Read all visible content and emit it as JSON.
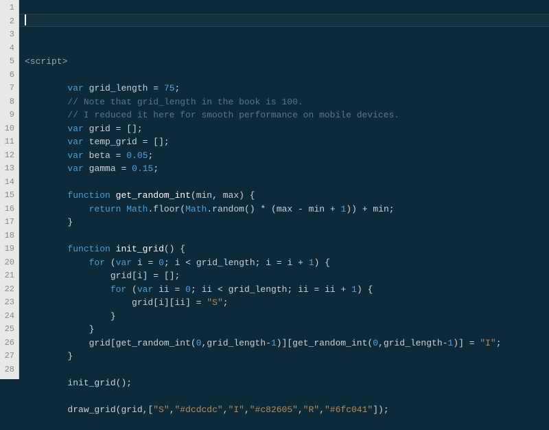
{
  "lines": [
    {
      "n": 1,
      "segs": [
        {
          "c": "tag",
          "t": "<script>"
        }
      ]
    },
    {
      "n": 2,
      "segs": []
    },
    {
      "n": 3,
      "segs": [
        {
          "c": "",
          "t": "        "
        },
        {
          "c": "kw",
          "t": "var"
        },
        {
          "c": "",
          "t": " "
        },
        {
          "c": "fn",
          "t": "grid_length"
        },
        {
          "c": "",
          "t": " "
        },
        {
          "c": "op",
          "t": "="
        },
        {
          "c": "",
          "t": " "
        },
        {
          "c": "num",
          "t": "75"
        },
        {
          "c": "punct",
          "t": ";"
        }
      ]
    },
    {
      "n": 4,
      "segs": [
        {
          "c": "",
          "t": "        "
        },
        {
          "c": "cm",
          "t": "// Note that grid_length in the book is 100."
        }
      ]
    },
    {
      "n": 5,
      "segs": [
        {
          "c": "",
          "t": "        "
        },
        {
          "c": "cm",
          "t": "// I reduced it here for smooth performance on mobile devices."
        }
      ]
    },
    {
      "n": 6,
      "segs": [
        {
          "c": "",
          "t": "        "
        },
        {
          "c": "kw",
          "t": "var"
        },
        {
          "c": "",
          "t": " "
        },
        {
          "c": "fn",
          "t": "grid"
        },
        {
          "c": "",
          "t": " "
        },
        {
          "c": "op",
          "t": "="
        },
        {
          "c": "",
          "t": " "
        },
        {
          "c": "punct",
          "t": "[]"
        },
        {
          "c": "punct",
          "t": ";"
        }
      ]
    },
    {
      "n": 7,
      "segs": [
        {
          "c": "",
          "t": "        "
        },
        {
          "c": "kw",
          "t": "var"
        },
        {
          "c": "",
          "t": " "
        },
        {
          "c": "fn",
          "t": "temp_grid"
        },
        {
          "c": "",
          "t": " "
        },
        {
          "c": "op",
          "t": "="
        },
        {
          "c": "",
          "t": " "
        },
        {
          "c": "punct",
          "t": "[]"
        },
        {
          "c": "punct",
          "t": ";"
        }
      ]
    },
    {
      "n": 8,
      "segs": [
        {
          "c": "",
          "t": "        "
        },
        {
          "c": "kw",
          "t": "var"
        },
        {
          "c": "",
          "t": " "
        },
        {
          "c": "fn",
          "t": "beta"
        },
        {
          "c": "",
          "t": " "
        },
        {
          "c": "op",
          "t": "="
        },
        {
          "c": "",
          "t": " "
        },
        {
          "c": "num",
          "t": "0.05"
        },
        {
          "c": "punct",
          "t": ";"
        }
      ]
    },
    {
      "n": 9,
      "segs": [
        {
          "c": "",
          "t": "        "
        },
        {
          "c": "kw",
          "t": "var"
        },
        {
          "c": "",
          "t": " "
        },
        {
          "c": "fn",
          "t": "gamma"
        },
        {
          "c": "",
          "t": " "
        },
        {
          "c": "op",
          "t": "="
        },
        {
          "c": "",
          "t": " "
        },
        {
          "c": "num",
          "t": "0.15"
        },
        {
          "c": "punct",
          "t": ";"
        }
      ]
    },
    {
      "n": 10,
      "segs": []
    },
    {
      "n": 11,
      "segs": [
        {
          "c": "",
          "t": "        "
        },
        {
          "c": "kw",
          "t": "function"
        },
        {
          "c": "",
          "t": " "
        },
        {
          "c": "white",
          "t": "get_random_int"
        },
        {
          "c": "punct",
          "t": "("
        },
        {
          "c": "fn",
          "t": "min"
        },
        {
          "c": "punct",
          "t": ","
        },
        {
          "c": "",
          "t": " "
        },
        {
          "c": "fn",
          "t": "max"
        },
        {
          "c": "punct",
          "t": ")"
        },
        {
          "c": "",
          "t": " "
        },
        {
          "c": "punct",
          "t": "{"
        }
      ]
    },
    {
      "n": 12,
      "segs": [
        {
          "c": "",
          "t": "            "
        },
        {
          "c": "kw",
          "t": "return"
        },
        {
          "c": "",
          "t": " "
        },
        {
          "c": "obj",
          "t": "Math"
        },
        {
          "c": "punct",
          "t": "."
        },
        {
          "c": "call",
          "t": "floor"
        },
        {
          "c": "punct",
          "t": "("
        },
        {
          "c": "obj",
          "t": "Math"
        },
        {
          "c": "punct",
          "t": "."
        },
        {
          "c": "call",
          "t": "random"
        },
        {
          "c": "punct",
          "t": "()"
        },
        {
          "c": "",
          "t": " "
        },
        {
          "c": "op",
          "t": "*"
        },
        {
          "c": "",
          "t": " "
        },
        {
          "c": "punct",
          "t": "("
        },
        {
          "c": "fn",
          "t": "max"
        },
        {
          "c": "",
          "t": " "
        },
        {
          "c": "op",
          "t": "-"
        },
        {
          "c": "",
          "t": " "
        },
        {
          "c": "fn",
          "t": "min"
        },
        {
          "c": "",
          "t": " "
        },
        {
          "c": "op",
          "t": "+"
        },
        {
          "c": "",
          "t": " "
        },
        {
          "c": "num",
          "t": "1"
        },
        {
          "c": "punct",
          "t": "))"
        },
        {
          "c": "",
          "t": " "
        },
        {
          "c": "op",
          "t": "+"
        },
        {
          "c": "",
          "t": " "
        },
        {
          "c": "fn",
          "t": "min"
        },
        {
          "c": "punct",
          "t": ";"
        }
      ]
    },
    {
      "n": 13,
      "segs": [
        {
          "c": "",
          "t": "        "
        },
        {
          "c": "punct",
          "t": "}"
        }
      ]
    },
    {
      "n": 14,
      "segs": []
    },
    {
      "n": 15,
      "segs": [
        {
          "c": "",
          "t": "        "
        },
        {
          "c": "kw",
          "t": "function"
        },
        {
          "c": "",
          "t": " "
        },
        {
          "c": "white",
          "t": "init_grid"
        },
        {
          "c": "punct",
          "t": "()"
        },
        {
          "c": "",
          "t": " "
        },
        {
          "c": "punct",
          "t": "{"
        }
      ]
    },
    {
      "n": 16,
      "segs": [
        {
          "c": "",
          "t": "            "
        },
        {
          "c": "kw",
          "t": "for"
        },
        {
          "c": "",
          "t": " "
        },
        {
          "c": "punct",
          "t": "("
        },
        {
          "c": "kw",
          "t": "var"
        },
        {
          "c": "",
          "t": " "
        },
        {
          "c": "fn",
          "t": "i"
        },
        {
          "c": "",
          "t": " "
        },
        {
          "c": "op",
          "t": "="
        },
        {
          "c": "",
          "t": " "
        },
        {
          "c": "num",
          "t": "0"
        },
        {
          "c": "punct",
          "t": ";"
        },
        {
          "c": "",
          "t": " "
        },
        {
          "c": "fn",
          "t": "i"
        },
        {
          "c": "",
          "t": " "
        },
        {
          "c": "op",
          "t": "<"
        },
        {
          "c": "",
          "t": " "
        },
        {
          "c": "fn",
          "t": "grid_length"
        },
        {
          "c": "punct",
          "t": ";"
        },
        {
          "c": "",
          "t": " "
        },
        {
          "c": "fn",
          "t": "i"
        },
        {
          "c": "",
          "t": " "
        },
        {
          "c": "op",
          "t": "="
        },
        {
          "c": "",
          "t": " "
        },
        {
          "c": "fn",
          "t": "i"
        },
        {
          "c": "",
          "t": " "
        },
        {
          "c": "op",
          "t": "+"
        },
        {
          "c": "",
          "t": " "
        },
        {
          "c": "num",
          "t": "1"
        },
        {
          "c": "punct",
          "t": ")"
        },
        {
          "c": "",
          "t": " "
        },
        {
          "c": "punct",
          "t": "{"
        }
      ]
    },
    {
      "n": 17,
      "segs": [
        {
          "c": "",
          "t": "                "
        },
        {
          "c": "fn",
          "t": "grid"
        },
        {
          "c": "punct",
          "t": "["
        },
        {
          "c": "fn",
          "t": "i"
        },
        {
          "c": "punct",
          "t": "]"
        },
        {
          "c": "",
          "t": " "
        },
        {
          "c": "op",
          "t": "="
        },
        {
          "c": "",
          "t": " "
        },
        {
          "c": "punct",
          "t": "[]"
        },
        {
          "c": "punct",
          "t": ";"
        }
      ]
    },
    {
      "n": 18,
      "segs": [
        {
          "c": "",
          "t": "                "
        },
        {
          "c": "kw",
          "t": "for"
        },
        {
          "c": "",
          "t": " "
        },
        {
          "c": "punct",
          "t": "("
        },
        {
          "c": "kw",
          "t": "var"
        },
        {
          "c": "",
          "t": " "
        },
        {
          "c": "fn",
          "t": "ii"
        },
        {
          "c": "",
          "t": " "
        },
        {
          "c": "op",
          "t": "="
        },
        {
          "c": "",
          "t": " "
        },
        {
          "c": "num",
          "t": "0"
        },
        {
          "c": "punct",
          "t": ";"
        },
        {
          "c": "",
          "t": " "
        },
        {
          "c": "fn",
          "t": "ii"
        },
        {
          "c": "",
          "t": " "
        },
        {
          "c": "op",
          "t": "<"
        },
        {
          "c": "",
          "t": " "
        },
        {
          "c": "fn",
          "t": "grid_length"
        },
        {
          "c": "punct",
          "t": ";"
        },
        {
          "c": "",
          "t": " "
        },
        {
          "c": "fn",
          "t": "ii"
        },
        {
          "c": "",
          "t": " "
        },
        {
          "c": "op",
          "t": "="
        },
        {
          "c": "",
          "t": " "
        },
        {
          "c": "fn",
          "t": "ii"
        },
        {
          "c": "",
          "t": " "
        },
        {
          "c": "op",
          "t": "+"
        },
        {
          "c": "",
          "t": " "
        },
        {
          "c": "num",
          "t": "1"
        },
        {
          "c": "punct",
          "t": ")"
        },
        {
          "c": "",
          "t": " "
        },
        {
          "c": "punct",
          "t": "{"
        }
      ]
    },
    {
      "n": 19,
      "segs": [
        {
          "c": "",
          "t": "                    "
        },
        {
          "c": "fn",
          "t": "grid"
        },
        {
          "c": "punct",
          "t": "["
        },
        {
          "c": "fn",
          "t": "i"
        },
        {
          "c": "punct",
          "t": "]["
        },
        {
          "c": "fn",
          "t": "ii"
        },
        {
          "c": "punct",
          "t": "]"
        },
        {
          "c": "",
          "t": " "
        },
        {
          "c": "op",
          "t": "="
        },
        {
          "c": "",
          "t": " "
        },
        {
          "c": "str",
          "t": "\"S\""
        },
        {
          "c": "punct",
          "t": ";"
        }
      ]
    },
    {
      "n": 20,
      "segs": [
        {
          "c": "",
          "t": "                "
        },
        {
          "c": "punct",
          "t": "}"
        }
      ]
    },
    {
      "n": 21,
      "segs": [
        {
          "c": "",
          "t": "            "
        },
        {
          "c": "punct",
          "t": "}"
        }
      ]
    },
    {
      "n": 22,
      "segs": [
        {
          "c": "",
          "t": "            "
        },
        {
          "c": "fn",
          "t": "grid"
        },
        {
          "c": "punct",
          "t": "["
        },
        {
          "c": "call",
          "t": "get_random_int"
        },
        {
          "c": "punct",
          "t": "("
        },
        {
          "c": "num",
          "t": "0"
        },
        {
          "c": "punct",
          "t": ","
        },
        {
          "c": "fn",
          "t": "grid_length"
        },
        {
          "c": "op",
          "t": "-"
        },
        {
          "c": "num",
          "t": "1"
        },
        {
          "c": "punct",
          "t": ")]["
        },
        {
          "c": "call",
          "t": "get_random_int"
        },
        {
          "c": "punct",
          "t": "("
        },
        {
          "c": "num",
          "t": "0"
        },
        {
          "c": "punct",
          "t": ","
        },
        {
          "c": "fn",
          "t": "grid_length"
        },
        {
          "c": "op",
          "t": "-"
        },
        {
          "c": "num",
          "t": "1"
        },
        {
          "c": "punct",
          "t": ")]"
        },
        {
          "c": "",
          "t": " "
        },
        {
          "c": "op",
          "t": "="
        },
        {
          "c": "",
          "t": " "
        },
        {
          "c": "str",
          "t": "\"I\""
        },
        {
          "c": "punct",
          "t": ";"
        }
      ]
    },
    {
      "n": 23,
      "segs": [
        {
          "c": "",
          "t": "        "
        },
        {
          "c": "punct",
          "t": "}"
        }
      ]
    },
    {
      "n": 24,
      "segs": []
    },
    {
      "n": 25,
      "segs": [
        {
          "c": "",
          "t": "        "
        },
        {
          "c": "call",
          "t": "init_grid"
        },
        {
          "c": "punct",
          "t": "();"
        }
      ]
    },
    {
      "n": 26,
      "segs": []
    },
    {
      "n": 27,
      "segs": [
        {
          "c": "",
          "t": "        "
        },
        {
          "c": "call",
          "t": "draw_grid"
        },
        {
          "c": "punct",
          "t": "("
        },
        {
          "c": "fn",
          "t": "grid"
        },
        {
          "c": "punct",
          "t": ",["
        },
        {
          "c": "str",
          "t": "\"S\""
        },
        {
          "c": "punct",
          "t": ","
        },
        {
          "c": "str",
          "t": "\"#dcdcdc\""
        },
        {
          "c": "punct",
          "t": ","
        },
        {
          "c": "str",
          "t": "\"I\""
        },
        {
          "c": "punct",
          "t": ","
        },
        {
          "c": "str",
          "t": "\"#c82605\""
        },
        {
          "c": "punct",
          "t": ","
        },
        {
          "c": "str",
          "t": "\"R\""
        },
        {
          "c": "punct",
          "t": ","
        },
        {
          "c": "str",
          "t": "\"#6fc041\""
        },
        {
          "c": "punct",
          "t": "]);"
        }
      ]
    },
    {
      "n": 28,
      "segs": []
    }
  ],
  "cursor_line_index": 1
}
